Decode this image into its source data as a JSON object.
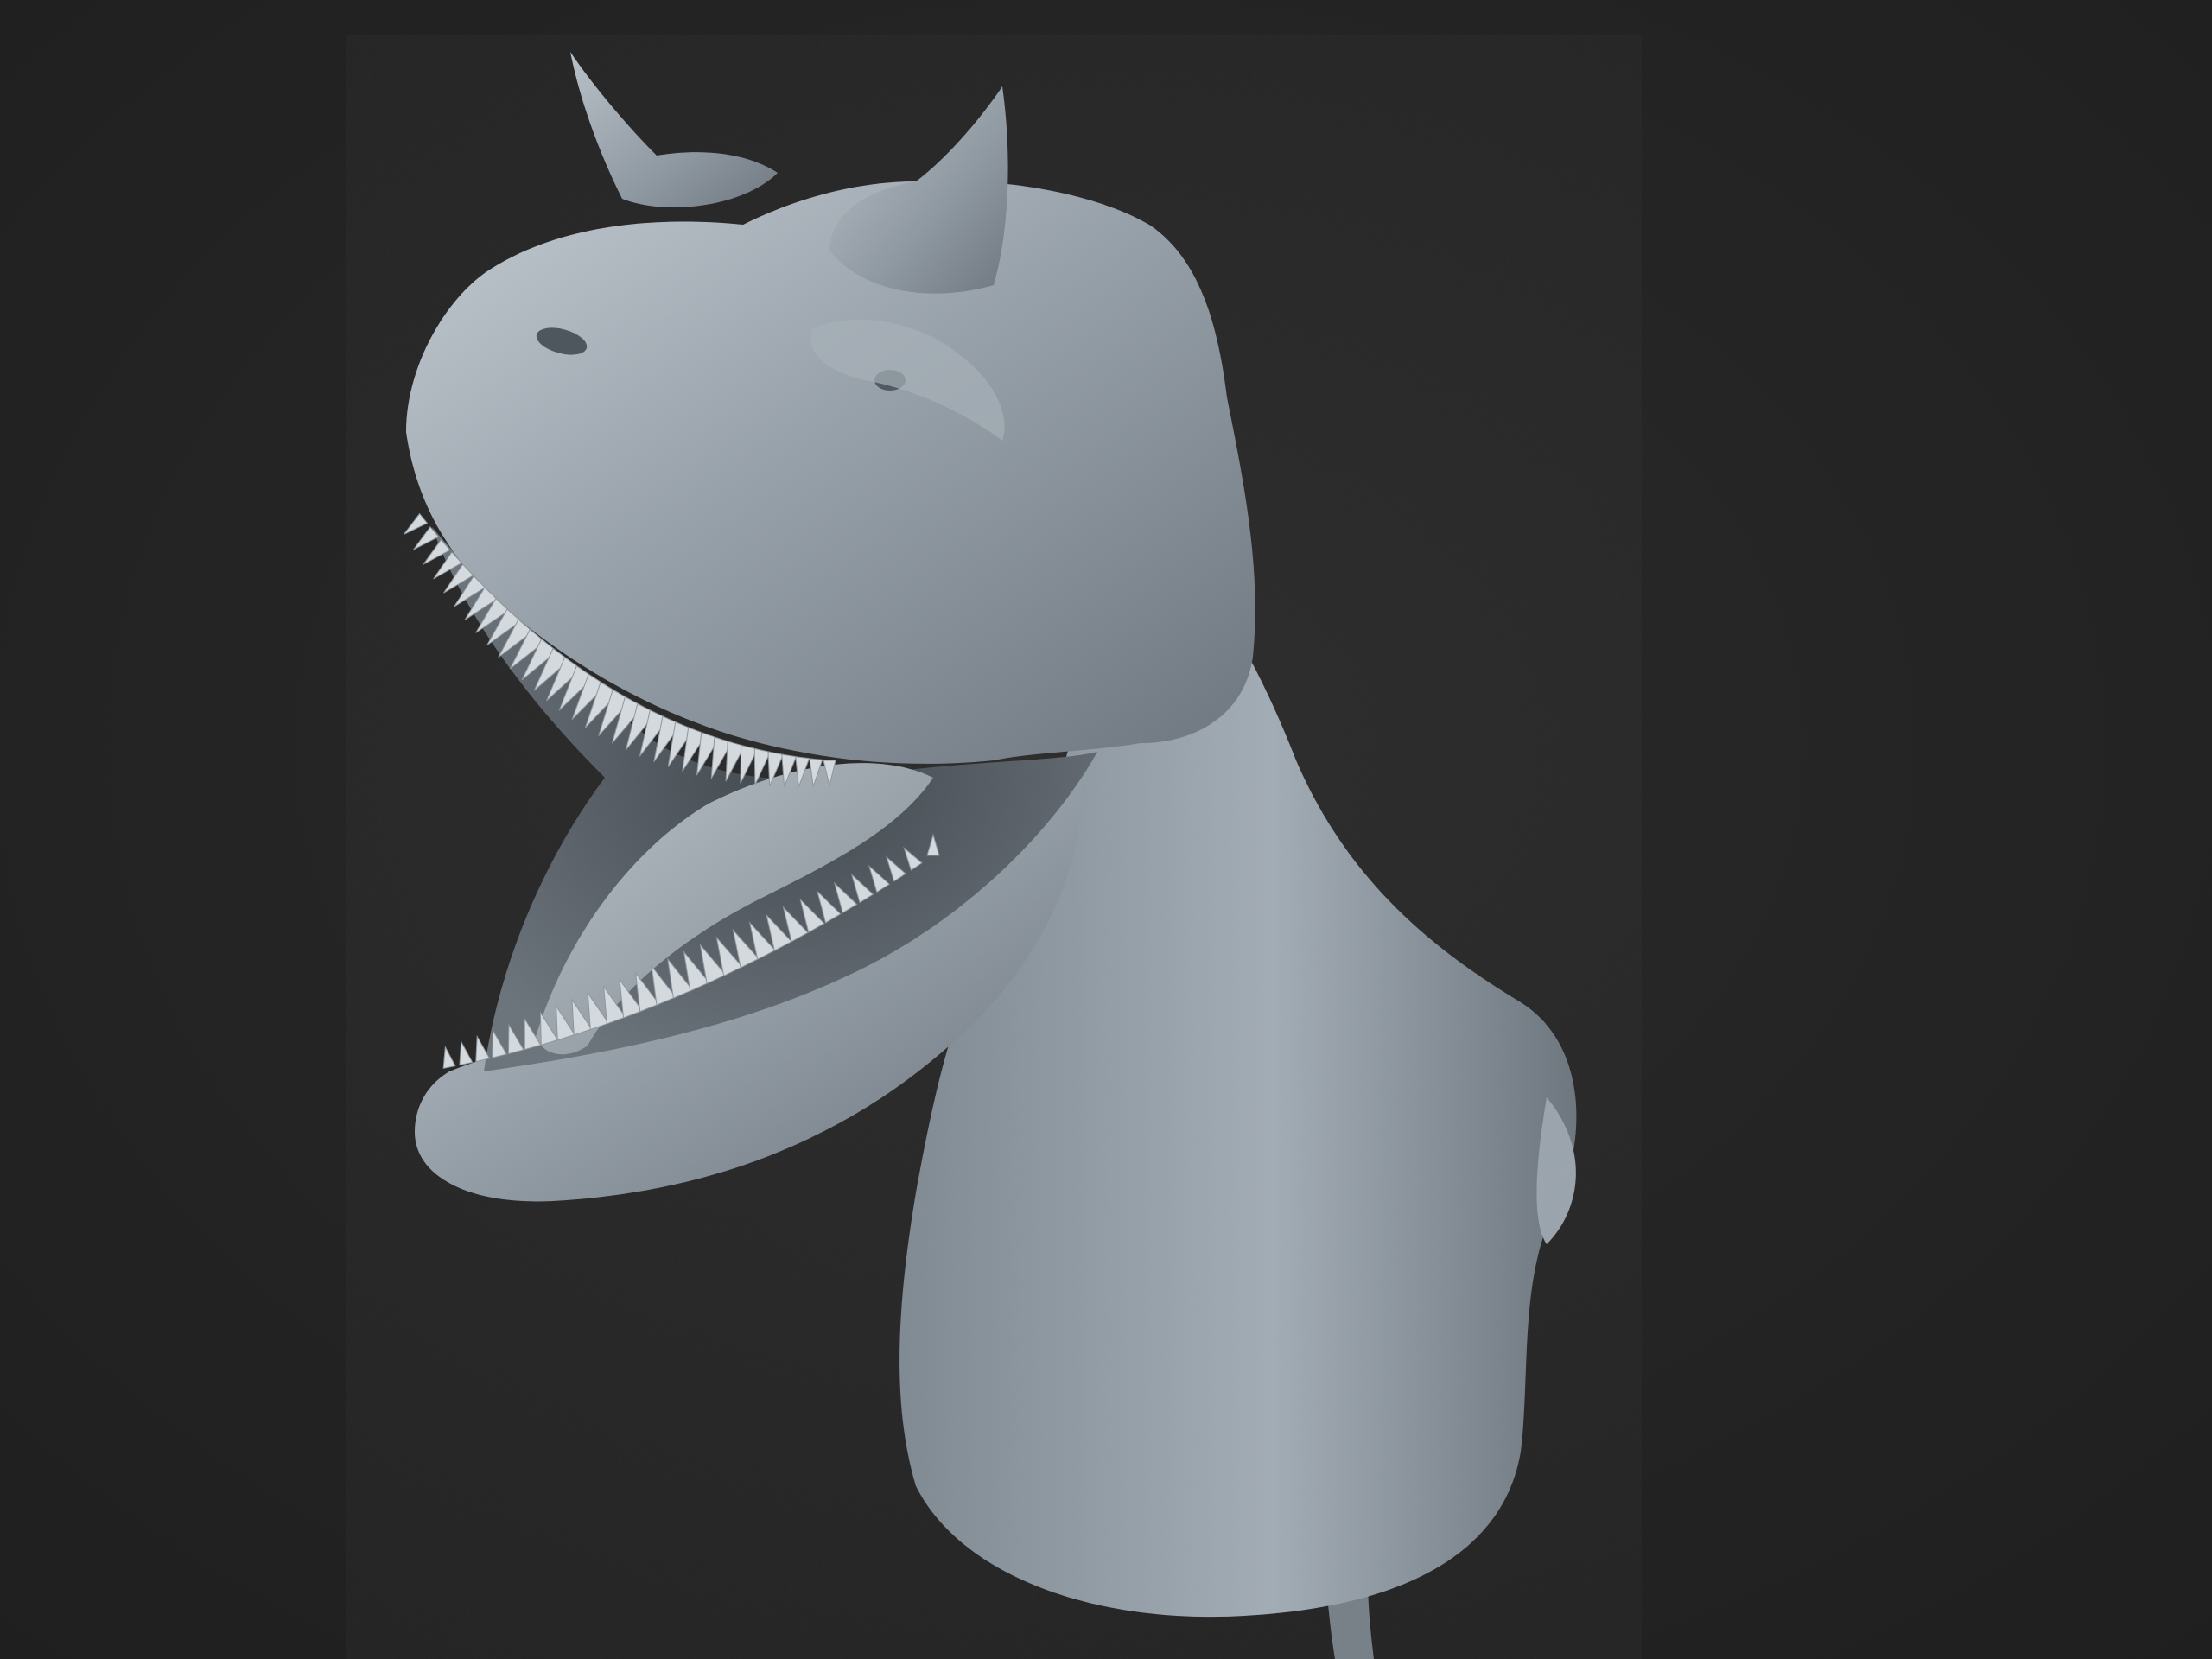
{
  "scene": {
    "subject": "sculpted-dinosaur-bust",
    "render_style": "clay",
    "colors": {
      "background": "#252525",
      "clay": "#8c969f",
      "clay_light": "#bfc7ce",
      "clay_shadow": "#4a5158",
      "mouth_inner": "#5c646b",
      "teeth": "#d4dade"
    }
  }
}
